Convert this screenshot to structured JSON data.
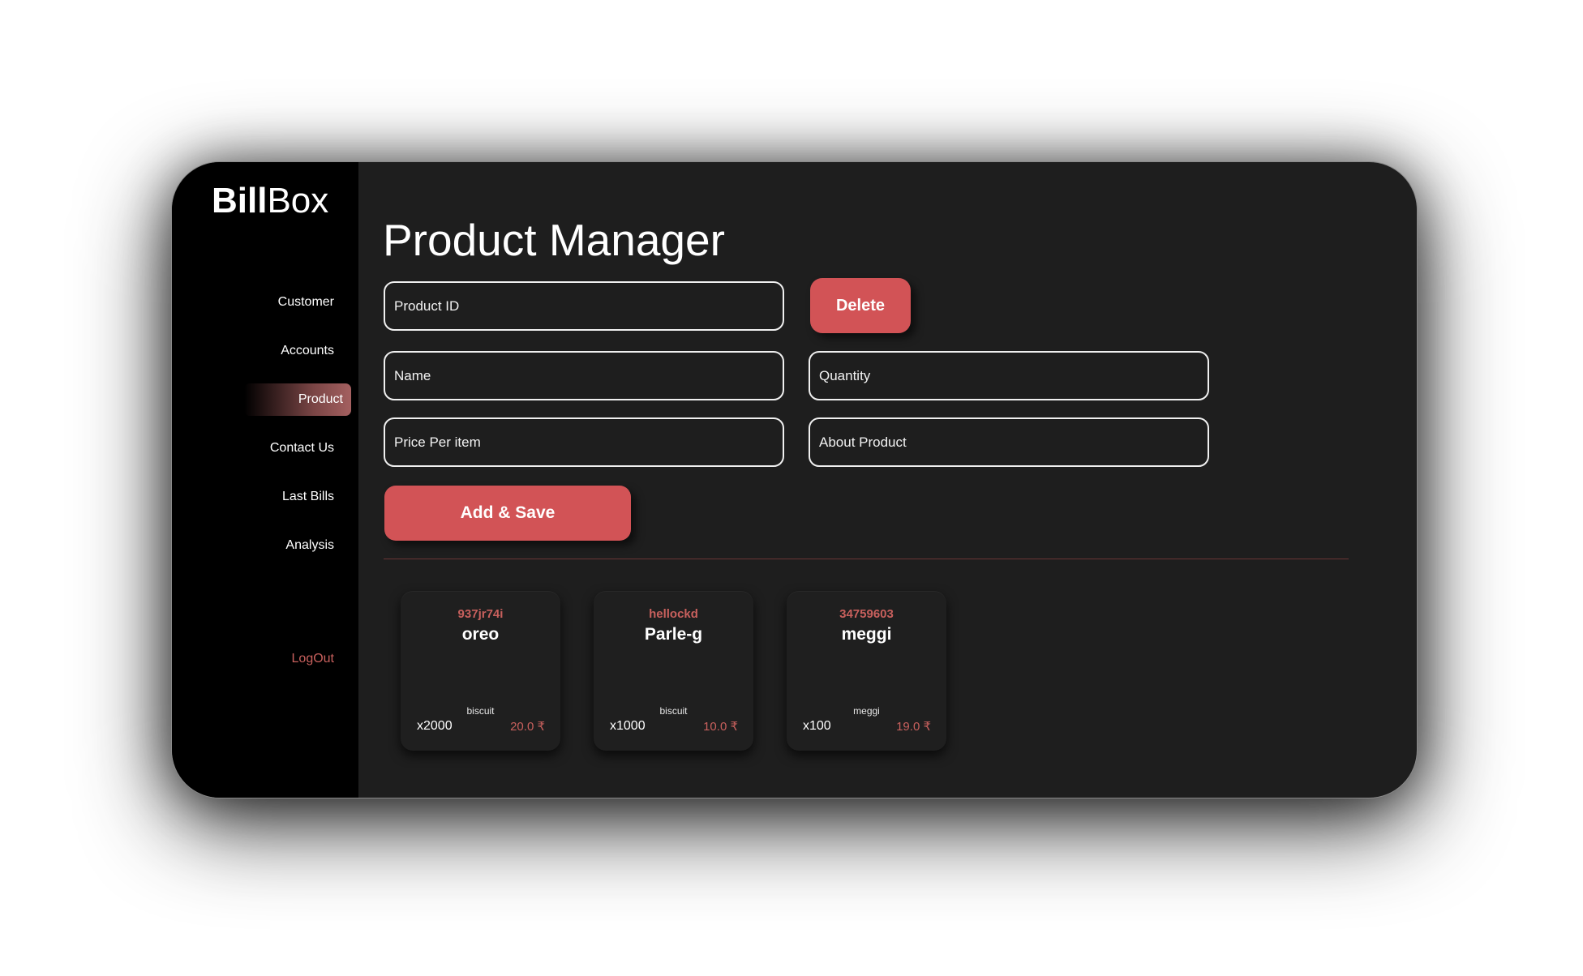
{
  "brand": {
    "part1": "Bill",
    "part2": "Box"
  },
  "sidebar": {
    "items": [
      {
        "label": "Customer"
      },
      {
        "label": "Accounts"
      },
      {
        "label": "Product"
      },
      {
        "label": "Contact Us"
      },
      {
        "label": "Last Bills"
      },
      {
        "label": "Analysis"
      }
    ],
    "active": "Product",
    "logout_label": "LogOut"
  },
  "page": {
    "title": "Product Manager"
  },
  "form": {
    "product_id_placeholder": "Product ID",
    "name_placeholder": "Name",
    "quantity_placeholder": "Quantity",
    "price_placeholder": "Price Per item",
    "about_placeholder": "About Product",
    "delete_label": "Delete",
    "save_label": "Add & Save"
  },
  "products": [
    {
      "id": "937jr74i",
      "name": "oreo",
      "about": "biscuit",
      "qty": "x2000",
      "price": "20.0 ₹"
    },
    {
      "id": "hellockd",
      "name": "Parle-g",
      "about": "biscuit",
      "qty": "x1000",
      "price": "10.0 ₹"
    },
    {
      "id": "34759603",
      "name": "meggi",
      "about": "meggi",
      "qty": "x100",
      "price": "19.0 ₹"
    }
  ],
  "colors": {
    "accent": "#d25356",
    "accent_text": "#c8605d",
    "panel": "#1e1e1e",
    "sidebar": "#000000"
  }
}
